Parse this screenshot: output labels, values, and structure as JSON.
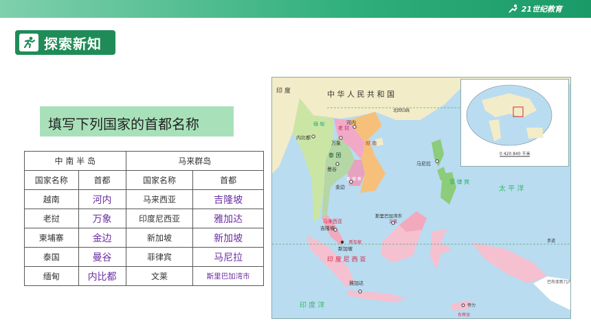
{
  "header": {
    "brand_text": "21世纪教育"
  },
  "section": {
    "title": "探索新知"
  },
  "task": {
    "prompt": "填写下列国家的首都名称"
  },
  "table": {
    "region_left": "中 南 半 岛",
    "region_right": "马来群岛",
    "col_country": "国家名称",
    "col_capital": "首都",
    "rows": [
      {
        "c1": "越南",
        "a1": "河内",
        "c2": "马来西亚",
        "a2": "吉隆坡"
      },
      {
        "c1": "老挝",
        "a1": "万象",
        "c2": "印度尼西亚",
        "a2": "雅加达"
      },
      {
        "c1": "柬埔寨",
        "a1": "金边",
        "c2": "新加坡",
        "a2": "新加坡"
      },
      {
        "c1": "泰国",
        "a1": "曼谷",
        "c2": "菲律宾",
        "a2": "马尼拉"
      },
      {
        "c1": "缅甸",
        "a1": "内比都",
        "c2": "文莱",
        "a2": "斯里巴加湾市"
      }
    ]
  },
  "map": {
    "china": "中 华 人 民 共 和 国",
    "india": "印 度",
    "tropic": "北回归线",
    "equator": "赤道",
    "pacific": "太 平 洋",
    "indian_ocean": "印 度 洋",
    "scale_text": "0 420 840 千米",
    "countries": {
      "myanmar": "缅 甸",
      "laos": "老 挝",
      "vietnam": "越 南",
      "thailand": "泰 国",
      "cambodia": "柬 埔 寨",
      "philippines": "菲 律 宾",
      "malaysia": "马来西亚",
      "indonesia": "印 度 尼 西 亚",
      "brunei": "文莱",
      "singapore": "新加坡",
      "east_timor": "东帝汶",
      "png": "巴布亚新几内亚"
    },
    "cities": {
      "naypyidaw": "内比都",
      "hanoi": "河内",
      "vientiane": "万象",
      "bangkok": "曼谷",
      "phnom_penh": "金边",
      "manila": "马尼拉",
      "kuala_lumpur": "吉隆坡",
      "singapore": "新加坡",
      "bandar": "斯里巴加湾市",
      "jakarta": "雅加达",
      "dili": "帝力"
    },
    "colors": {
      "sea": "#b9dcf0",
      "land": "#f3ecc8",
      "myanmar": "#cbe6a4",
      "thailand": "#b5d7a5",
      "laos": "#f2a9c8",
      "vietnam": "#f6c07a",
      "cambodia": "#e6a2c0",
      "philippines": "#8ccc7a",
      "malaysia": "#f2a9bd",
      "indonesia": "#f5c0d0",
      "png": "#ffffff"
    }
  }
}
